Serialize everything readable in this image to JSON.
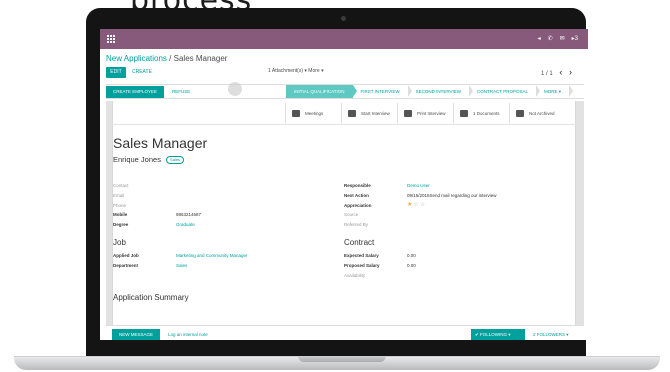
{
  "headline": "process",
  "topbar": {
    "sys_icons": [
      "◂",
      "✆",
      "✉",
      "▸3"
    ]
  },
  "breadcrumb": {
    "parent": "New Applications",
    "separator": "/",
    "current": "Sales Manager"
  },
  "toolbar": {
    "edit_label": "EDIT",
    "create_label": "CREATE",
    "actions_label": "1 Attachment(s) ▾   More ▾",
    "pager": "1 / 1"
  },
  "statusbar": {
    "create_employee": "CREATE EMPLOYEE",
    "refuse": "REFUSE",
    "stages": [
      "INITIAL QUALIFICATION",
      "FIRST INTERVIEW",
      "SECOND INTERVIEW",
      "CONTRACT PROPOSAL",
      "MORE ▾"
    ],
    "active_stage": "INITIAL QUALIFICATION"
  },
  "smart_buttons": [
    {
      "label": "Meetings",
      "icon": "calendar-icon"
    },
    {
      "label": "Start Interview",
      "icon": "person-icon"
    },
    {
      "label": "Print Interview",
      "icon": "printer-icon"
    },
    {
      "label": "1 Documents",
      "icon": "book-icon"
    },
    {
      "label": "Not Archived",
      "icon": "archive-icon"
    }
  ],
  "record": {
    "title": "Sales Manager",
    "applicant": "Enrique Jones",
    "tag": "Sales"
  },
  "left_fields": [
    {
      "label": "Contact",
      "value": ""
    },
    {
      "label": "Email",
      "value": ""
    },
    {
      "label": "Phone",
      "value": ""
    },
    {
      "label": "Mobile",
      "value": "9863214687"
    },
    {
      "label": "Degree",
      "value": "Graduate"
    }
  ],
  "right_fields": [
    {
      "label": "Responsible",
      "value": "Demo User"
    },
    {
      "label": "Next Action",
      "value": "09/15/2016Send mail regarding our interview"
    },
    {
      "label": "Appreciation",
      "value": ""
    },
    {
      "label": "Source",
      "value": ""
    },
    {
      "label": "Referred By",
      "value": ""
    }
  ],
  "appreciation_stars": 1,
  "job": {
    "title": "Job",
    "fields": [
      {
        "label": "Applied Job",
        "value": "Marketing and Community Manager"
      },
      {
        "label": "Department",
        "value": "Sales"
      }
    ]
  },
  "contract": {
    "title": "Contract",
    "fields": [
      {
        "label": "Expected Salary",
        "value": "0.00"
      },
      {
        "label": "Proposed Salary",
        "value": "0.00"
      },
      {
        "label": "Availability",
        "value": ""
      }
    ]
  },
  "summary_title": "Application Summary",
  "chatter": {
    "new_message": "NEW MESSAGE",
    "log_note": "Log an internal note",
    "following": "✔ FOLLOWING   ▾",
    "followers": "2 FOLLOWERS  ▾"
  }
}
